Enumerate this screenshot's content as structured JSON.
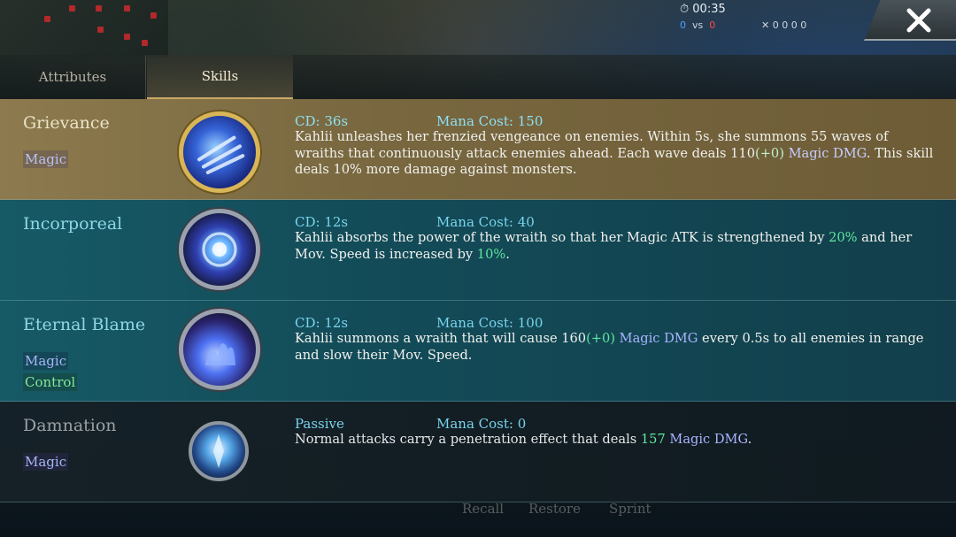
{
  "hud": {
    "time": "00:35",
    "score_blue": "0",
    "vs": "vs",
    "score_red": "0",
    "stats": "0   0   0   0"
  },
  "tabs": [
    {
      "label": "Attributes",
      "active": false
    },
    {
      "label": "Skills",
      "active": true
    }
  ],
  "skills": [
    {
      "name": "Grievance",
      "tags": [
        "Magic"
      ],
      "cd": "CD: 36s",
      "mana": "Mana Cost: 150",
      "desc_parts": [
        {
          "t": "Kahlii unleashes her frenzied vengeance on enemies. Within 5s, she summons 55 waves of wraiths that continuously attack enemies ahead. Each wave deals 110",
          "c": ""
        },
        {
          "t": "(+0)",
          "c": "green"
        },
        {
          "t": " ",
          "c": ""
        },
        {
          "t": "Magic DMG",
          "c": "blue"
        },
        {
          "t": ". This skill deals 10% more damage against monsters.",
          "c": ""
        }
      ],
      "icon": "wraith-wave-icon"
    },
    {
      "name": "Incorporeal",
      "tags": [],
      "cd": "CD: 12s",
      "mana": "Mana Cost: 40",
      "desc_parts": [
        {
          "t": "Kahlii absorbs the power of the wraith so that her Magic ATK is strengthened by ",
          "c": ""
        },
        {
          "t": "20%",
          "c": "green"
        },
        {
          "t": " and her Mov. Speed is increased by ",
          "c": ""
        },
        {
          "t": "10%",
          "c": "green"
        },
        {
          "t": ".",
          "c": ""
        }
      ],
      "icon": "spirit-orb-icon"
    },
    {
      "name": "Eternal Blame",
      "tags": [
        "Magic",
        "Control"
      ],
      "cd": "CD: 12s",
      "mana": "Mana Cost: 100",
      "desc_parts": [
        {
          "t": "Kahlii summons a wraith that will cause 160",
          "c": ""
        },
        {
          "t": "(+0)",
          "c": "green"
        },
        {
          "t": " ",
          "c": ""
        },
        {
          "t": "Magic DMG",
          "c": "blue"
        },
        {
          "t": " every 0.5s to all enemies in range and slow their Mov. Speed.",
          "c": ""
        }
      ],
      "icon": "blue-flame-icon"
    },
    {
      "name": "Damnation",
      "tags": [
        "Magic"
      ],
      "cd": "Passive",
      "mana": "Mana Cost: 0",
      "desc_parts": [
        {
          "t": "Normal attacks carry a penetration effect that deals ",
          "c": ""
        },
        {
          "t": "157",
          "c": "green"
        },
        {
          "t": " ",
          "c": ""
        },
        {
          "t": "Magic DMG",
          "c": "blue"
        },
        {
          "t": ".",
          "c": ""
        }
      ],
      "icon": "ice-shard-icon"
    }
  ],
  "bottom_buttons": [
    "Recall",
    "Restore",
    "Sprint"
  ],
  "colors": {
    "accent_gold": "#c9a866",
    "highlight_green": "#5fe6a0",
    "highlight_blue": "#a9b4ff",
    "cd_text": "#79d4ec"
  }
}
